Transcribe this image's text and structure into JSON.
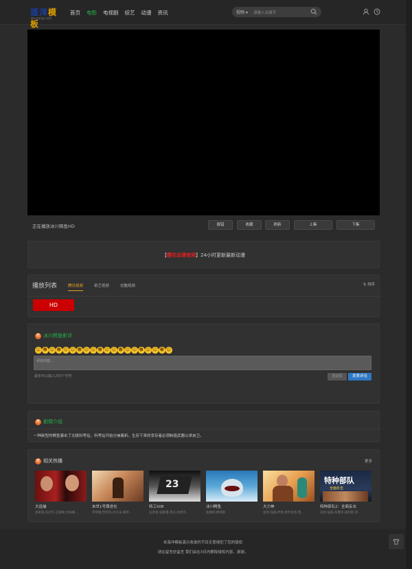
{
  "header": {
    "logo_text": "逐洋模板",
    "logo_sub": "zhuyang.com",
    "nav": [
      "首页",
      "电影",
      "电视剧",
      "综艺",
      "动漫",
      "资讯"
    ],
    "nav_active": 1,
    "search_select": "视频",
    "search_placeholder": "请输入关键字"
  },
  "player": {
    "now_playing": "正在播放冰川鳄鱼HD",
    "buttons": [
      "报错",
      "收藏",
      "刷新",
      "上集",
      "下集"
    ]
  },
  "notice": {
    "prefix": "【",
    "highlight": "樱花动漫官网",
    "suffix": "】24小时更新最新动漫"
  },
  "playlist": {
    "title": "播放列表",
    "tabs": [
      "腾讯视频",
      "奇艺视频",
      "优酷视频"
    ],
    "active_tab": 0,
    "sort_label": "排序",
    "episode": "HD"
  },
  "comment": {
    "title": "冰川鳄鱼影评",
    "emoji_count": 20,
    "placeholder": "评论内容...",
    "tip": "最多可以输入255个字符",
    "verify_button": "验证码",
    "submit_button": "发表评论"
  },
  "intro": {
    "title": "剧情介绍",
    "text": "一种新型的鳄鱼袭击了北极科考站，科考站开始分崩离析。生存下来的幸存者必须制造武器以求自卫。"
  },
  "hot": {
    "title": "相关热播",
    "more": "更多",
    "items": [
      {
        "name": "大追捕",
        "actor": "张家辉,任达华,王敏德,文咏珊..."
      },
      {
        "name": "末世1号罪进化",
        "actor": "李熙曈,贾欣阳,肖亿卓,黄继..."
      },
      {
        "name": "特工008",
        "actor": "吴彦祖,张懿璠,周迅,周佩莎..."
      },
      {
        "name": "冰川鳄鱼",
        "actor": "詹娜硕,穆瑞斯"
      },
      {
        "name": "大力神",
        "actor": "道恩·强森,伊恩·麦柯肖恩,鲁..."
      },
      {
        "name": "特种部队2：全面反击",
        "actor": "道恩·强森,布鲁斯·威利斯,李..."
      }
    ]
  },
  "footer": {
    "line1": "本海洋模板演示收录的节目无意侵犯了您的版权",
    "line2": "请在留言处留言 我们会在3日内删除侵权内容，谢谢。"
  },
  "colors": {
    "accent_green": "#26b34a",
    "notice_red": "#e02020",
    "tab_orange": "#e8a020",
    "hd_red": "#cc0000",
    "submit_blue": "#2f78c4"
  }
}
